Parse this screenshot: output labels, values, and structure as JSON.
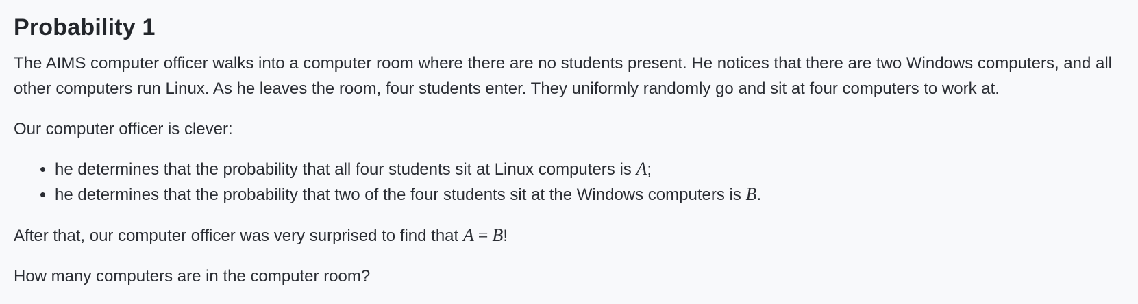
{
  "title": "Probability 1",
  "intro": "The AIMS computer officer walks into a computer room where there are no students present. He notices that there are two Windows computers, and all other computers run Linux. As he leaves the room, four students enter. They uniformly randomly go and sit at four computers to work at.",
  "clever": "Our computer officer is clever:",
  "bullets": [
    {
      "text": "he determines that the probability that all four students sit at Linux computers is ",
      "var": "A",
      "end": ";"
    },
    {
      "text": "he determines that the probability that two of the four students sit at the Windows computers is ",
      "var": "B",
      "end": "."
    }
  ],
  "surprise": {
    "text": "After that, our computer officer was very surprised to find that ",
    "lhs": "A",
    "op": "=",
    "rhs": "B",
    "end": "!"
  },
  "question": "How many computers are in the computer room?"
}
